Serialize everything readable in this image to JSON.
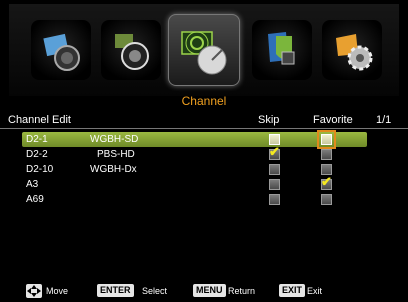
{
  "menu": {
    "title": "Channel",
    "icons": [
      "picture-icon",
      "audio-icon",
      "channel-icon",
      "lock-icon",
      "settings-icon"
    ],
    "selected_index": 2,
    "accent": "#f0a020"
  },
  "header": {
    "section": "Channel Edit",
    "skip": "Skip",
    "favorite": "Favorite",
    "page": "1/1"
  },
  "channels": [
    {
      "number": "D2-1",
      "name": "WGBH-SD",
      "skip": false,
      "favorite": false,
      "selected": true
    },
    {
      "number": "D2-2",
      "name": "PBS-HD",
      "skip": true,
      "favorite": false,
      "selected": false
    },
    {
      "number": "D2-10",
      "name": "WGBH-Dx",
      "skip": false,
      "favorite": false,
      "selected": false
    },
    {
      "number": "A3",
      "name": "",
      "skip": false,
      "favorite": true,
      "selected": false
    },
    {
      "number": "A69",
      "name": "",
      "skip": false,
      "favorite": false,
      "selected": false
    }
  ],
  "footer": {
    "move": "Move",
    "enter_key": "ENTER",
    "select": "Select",
    "menu_key": "MENU",
    "return": "Return",
    "exit_key": "EXIT",
    "exit": "Exit"
  },
  "colors": {
    "selected_row": "#8aa838",
    "focus": "#e08a1c",
    "check": "#f4e820"
  }
}
